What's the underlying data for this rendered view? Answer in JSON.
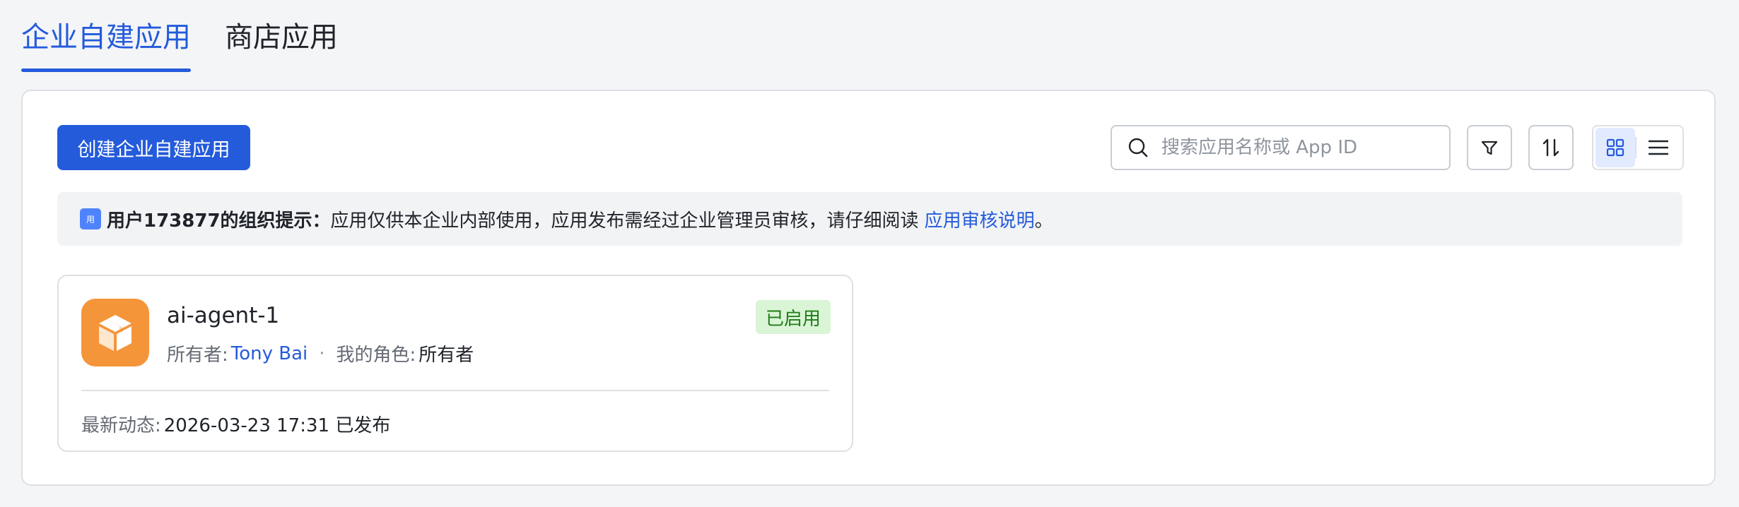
{
  "tabs": [
    {
      "label": "企业自建应用",
      "active": true
    },
    {
      "label": "商店应用",
      "active": false
    }
  ],
  "toolbar": {
    "create_label": "创建企业自建应用",
    "search_placeholder": "搜索应用名称或 App ID",
    "filter_icon": "filter-icon",
    "sort_icon": "sort-icon",
    "view_grid_icon": "grid-view-icon",
    "view_list_icon": "list-view-icon",
    "active_view": "grid"
  },
  "notice": {
    "badge": "用",
    "org_label": "用户173877的组织提示：",
    "text": "应用仅供本企业内部使用，应用发布需经过企业管理员审核，请仔细阅读",
    "link": "应用审核说明",
    "suffix": "。"
  },
  "apps": [
    {
      "name": "ai-agent-1",
      "status": "已启用",
      "owner_label": "所有者:",
      "owner": "Tony Bai",
      "separator": "·",
      "role_label": "我的角色:",
      "role": "所有者",
      "latest_label": "最新动态:",
      "latest": "2026-03-23 17:31 已发布",
      "icon": "package-box-icon"
    }
  ],
  "colors": {
    "accent": "#245bdb",
    "status_bg": "#d9f5d6",
    "status_text": "#237b19",
    "app_icon_bg": "#f5953a"
  }
}
